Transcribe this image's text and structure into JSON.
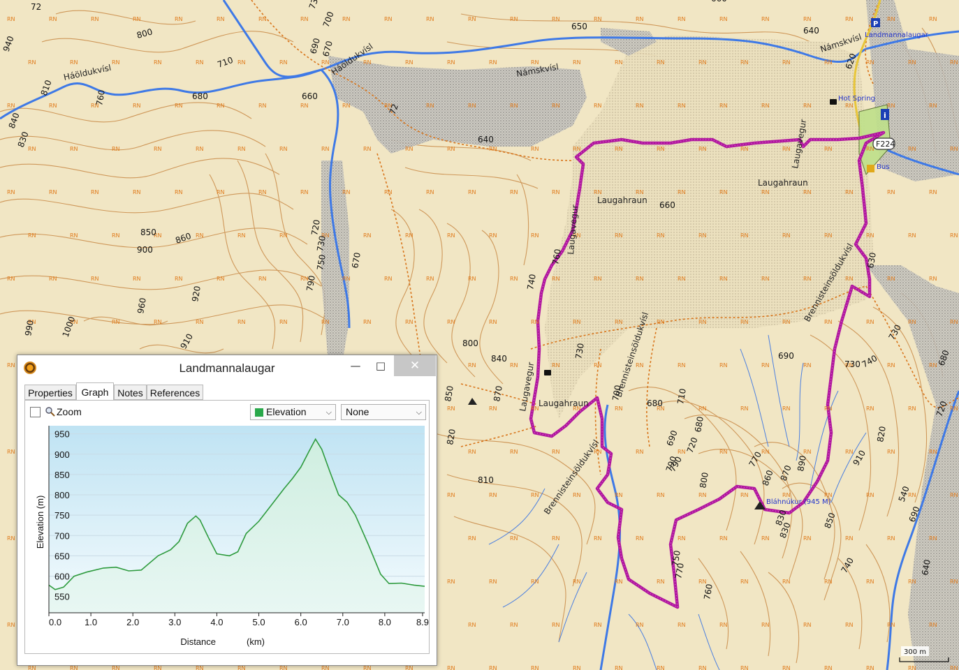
{
  "map": {
    "place_labels": [
      {
        "text": "Laugahraun"
      },
      {
        "text": "Laugahraun"
      },
      {
        "text": "Laugahraun"
      },
      {
        "text": "Háöldukvísl"
      },
      {
        "text": "Háöldukvísl"
      },
      {
        "text": "Námskvísl"
      },
      {
        "text": "Námskvísl"
      },
      {
        "text": "Brennisteinsöldukvísl"
      },
      {
        "text": "Brennisteinsöldukvísl"
      },
      {
        "text": "Brennisteinsöldukvísl"
      },
      {
        "text": "Laugavegur"
      },
      {
        "text": "Laugavegur"
      },
      {
        "text": "Laugavegur"
      }
    ],
    "poi_labels": {
      "landmannalaugar": "Landmannalaugar",
      "hot_spring": "Hot Spring",
      "bus": "Bus",
      "summit": "Bláhnúkur (945 M)",
      "road": "F224",
      "scale": "300 m"
    },
    "contour_numbers": [
      "940",
      "72",
      "730",
      "700",
      "690",
      "670",
      "650",
      "640",
      "660",
      "800",
      "710",
      "810",
      "760",
      "680",
      "660",
      "72",
      "620",
      "840",
      "830",
      "640",
      "850",
      "860",
      "900",
      "720",
      "730",
      "750",
      "670",
      "790",
      "660",
      "630",
      "740",
      "760",
      "730",
      "700",
      "690",
      "730",
      "740",
      "960",
      "920",
      "990",
      "1000",
      "910",
      "800",
      "840",
      "850",
      "870",
      "680",
      "710",
      "690",
      "680",
      "720",
      "770",
      "860",
      "870",
      "910",
      "820",
      "790",
      "830",
      "800",
      "820",
      "810",
      "890",
      "790",
      "850",
      "830",
      "740",
      "770",
      "760",
      "750",
      "720",
      "690",
      "640",
      "540",
      "730",
      "680"
    ],
    "rn_symbol": "RN",
    "colors": {
      "terrain": "#f1e6c4",
      "contour": "#c98a47",
      "river": "#3e79e6",
      "track": "#b0169e",
      "trail": "#d8741a",
      "lava": "#eae0bf"
    }
  },
  "window": {
    "title": "Landmannalaugar",
    "min_glyph": "—",
    "max_glyph": "□",
    "close_glyph": "✕"
  },
  "tabs": [
    {
      "label": "Properties",
      "active": false
    },
    {
      "label": "Graph",
      "active": true
    },
    {
      "label": "Notes",
      "active": false
    },
    {
      "label": "References",
      "active": false
    }
  ],
  "toolbar": {
    "zoom_label": "Zoom",
    "zoom_checked": false,
    "primary_select": {
      "value": "Elevation",
      "color": "#29a84a"
    },
    "secondary_select": {
      "value": "None"
    }
  },
  "chart_data": {
    "type": "area",
    "xlabel": "Distance",
    "xunit": "(km)",
    "ylabel": "Elevation (m)",
    "xlim": [
      0,
      8.95
    ],
    "ylim": [
      510,
      970
    ],
    "x_ticks": [
      "0.0",
      "1.0",
      "2.0",
      "3.0",
      "4.0",
      "5.0",
      "6.0",
      "7.0",
      "8.0",
      "8.9"
    ],
    "y_ticks": [
      "550",
      "600",
      "650",
      "700",
      "750",
      "800",
      "850",
      "900",
      "950"
    ],
    "grid": true,
    "line_color": "#2e9b3e",
    "x": [
      0.0,
      0.15,
      0.35,
      0.6,
      0.9,
      1.3,
      1.6,
      1.9,
      2.2,
      2.6,
      2.9,
      3.1,
      3.3,
      3.5,
      3.6,
      3.8,
      4.0,
      4.3,
      4.5,
      4.7,
      5.0,
      5.3,
      5.6,
      5.8,
      6.0,
      6.2,
      6.35,
      6.5,
      6.7,
      6.9,
      7.1,
      7.3,
      7.6,
      7.9,
      8.1,
      8.4,
      8.7,
      8.95
    ],
    "y": [
      578,
      567,
      573,
      600,
      610,
      620,
      622,
      613,
      615,
      650,
      665,
      685,
      730,
      748,
      738,
      695,
      655,
      650,
      660,
      705,
      735,
      775,
      815,
      840,
      868,
      908,
      937,
      912,
      855,
      800,
      782,
      750,
      680,
      605,
      582,
      583,
      578,
      575
    ]
  }
}
